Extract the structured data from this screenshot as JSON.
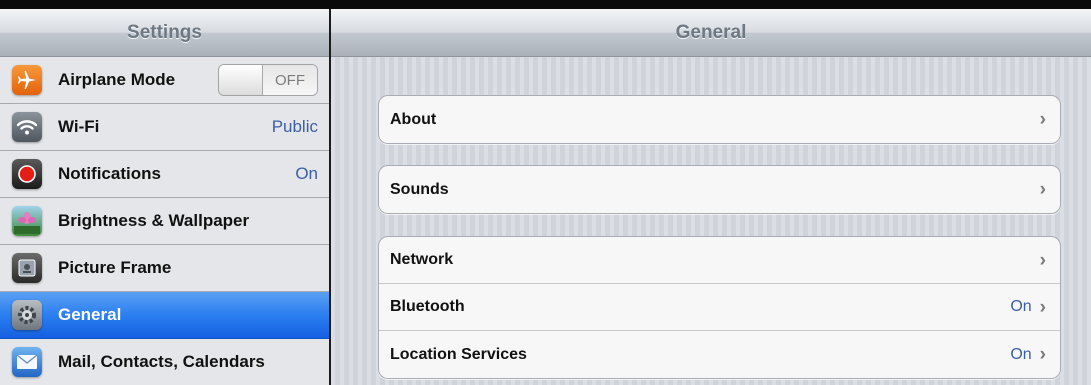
{
  "sidebar": {
    "title": "Settings",
    "airplane": {
      "label": "Airplane Mode",
      "toggle_text": "OFF",
      "icon": "airplane-icon"
    },
    "wifi": {
      "label": "Wi-Fi",
      "value": "Public",
      "icon": "wifi-icon"
    },
    "notifications": {
      "label": "Notifications",
      "value": "On",
      "icon": "notifications-icon"
    },
    "brightness": {
      "label": "Brightness & Wallpaper",
      "icon": "brightness-wallpaper-icon"
    },
    "picture_frame": {
      "label": "Picture Frame",
      "icon": "picture-frame-icon"
    },
    "general": {
      "label": "General",
      "icon": "gear-icon"
    },
    "mail": {
      "label": "Mail, Contacts, Calendars",
      "icon": "mail-icon"
    }
  },
  "detail": {
    "title": "General",
    "about": {
      "label": "About"
    },
    "sounds": {
      "label": "Sounds"
    },
    "network": {
      "label": "Network"
    },
    "bluetooth": {
      "label": "Bluetooth",
      "value": "On"
    },
    "location": {
      "label": "Location Services",
      "value": "On"
    },
    "chevron": "›"
  },
  "colors": {
    "selected_row": "#2c7ff0",
    "value_text": "#3b5fa3",
    "header_text": "#6e7883"
  }
}
